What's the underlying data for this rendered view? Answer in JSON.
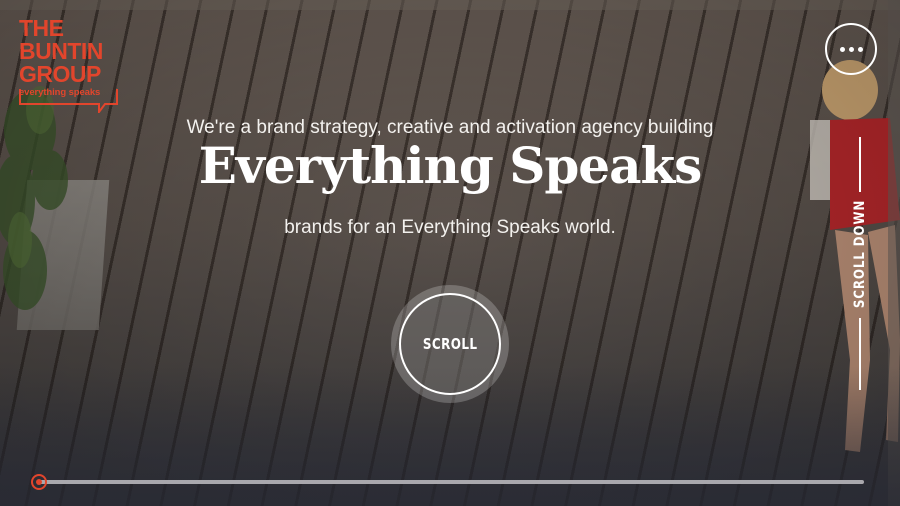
{
  "logo": {
    "lines": [
      "THE",
      "BUNTIN",
      "GROUP"
    ],
    "tagline": "everything speaks",
    "color": "#e2452c"
  },
  "menu": {
    "icon": "more-horizontal-icon"
  },
  "hero": {
    "tagline": "We're a brand strategy, creative and activation agency building",
    "headline": "Everything Speaks",
    "subline": "brands for an Everything Speaks world."
  },
  "scroll_button": {
    "label": "SCROLL"
  },
  "scroll_down": {
    "label": "SCROLL DOWN"
  },
  "progress": {
    "value": 0.0,
    "accent": "#e2452c",
    "track": "#a9a8ad"
  }
}
